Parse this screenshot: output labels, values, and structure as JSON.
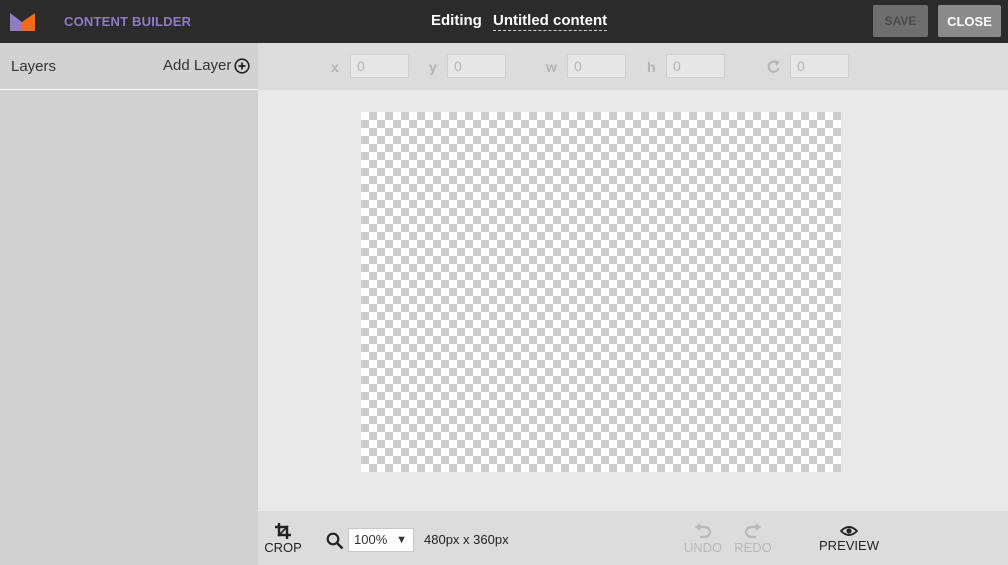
{
  "header": {
    "app_name": "CONTENT BUILDER",
    "editing_label": "Editing",
    "content_title": "Untitled content",
    "save_label": "SAVE",
    "close_label": "CLOSE",
    "logo_colors": {
      "left": "#8f7cc4",
      "right": "#f26a1b"
    }
  },
  "layers": {
    "title": "Layers",
    "add_label": "Add Layer",
    "add_icon": "plus-circle-icon"
  },
  "coords": {
    "x": {
      "label": "x",
      "value": "0"
    },
    "y": {
      "label": "y",
      "value": "0"
    },
    "w": {
      "label": "w",
      "value": "0"
    },
    "h": {
      "label": "h",
      "value": "0"
    },
    "rotation": {
      "icon": "rotate-icon",
      "value": "0"
    }
  },
  "toolbar": {
    "crop_label": "CROP",
    "zoom_value": "100%",
    "canvas_size": "480px x 360px",
    "undo_label": "UNDO",
    "redo_label": "REDO",
    "preview_label": "PREVIEW"
  }
}
